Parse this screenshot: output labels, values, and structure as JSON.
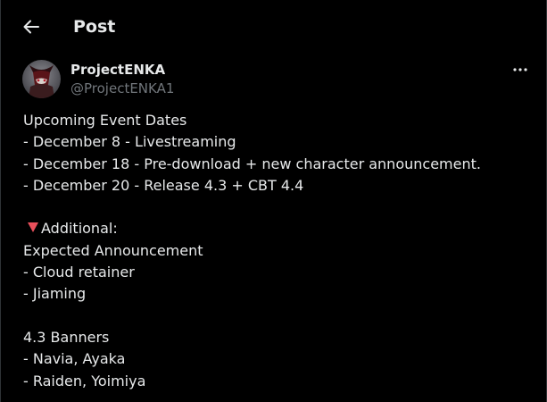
{
  "header": {
    "back_icon": "arrow-left-icon",
    "title": "Post"
  },
  "post": {
    "author": {
      "display_name": "ProjectENKA",
      "handle": "@ProjectENKA1",
      "avatar_icon": "avatar-image"
    },
    "more_icon": "more-horizontal-icon",
    "lines": {
      "l1": "Upcoming Event Dates",
      "l2": "- December 8 - Livestreaming",
      "l3": "- December 18 - Pre-download + new character announcement.",
      "l4": "- December 20 - Release 4.3 + CBT 4.4",
      "l5": "Additional:",
      "l6": "Expected Announcement",
      "l7": "- Cloud retainer",
      "l8": "- Jiaming",
      "l9": "4.3 Banners",
      "l10": "- Navia, Ayaka",
      "l11": "- Raiden, Yoimiya"
    },
    "emoji_icon": "red-triangle-down-icon"
  },
  "colors": {
    "background": "#000000",
    "text": "#e7e9ea",
    "muted": "#71767b",
    "emoji_red": "#e8505b"
  }
}
